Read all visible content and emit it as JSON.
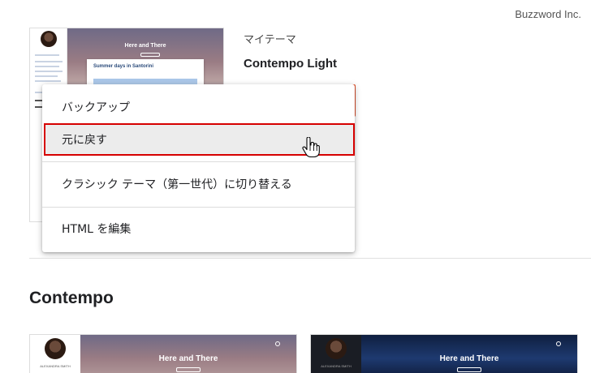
{
  "watermark": "Buzzword Inc.",
  "my_theme": {
    "label": "マイテーマ",
    "name": "Contempo Light",
    "preview": {
      "hero_title": "Here and There",
      "post_title": "Summer days in Santorini"
    }
  },
  "menu": {
    "items": [
      {
        "label": "バックアップ"
      },
      {
        "label": "元に戻す"
      },
      {
        "label": "クラシック テーマ（第一世代）に切り替える"
      },
      {
        "label": "HTML を編集"
      }
    ]
  },
  "section": {
    "title": "Contempo"
  },
  "thumbnails": [
    {
      "hero_title": "Here and There",
      "name": "ALEXANDRA SMITH"
    },
    {
      "hero_title": "Here and There",
      "name": "ALEXANDRA SMITH"
    }
  ],
  "colors": {
    "highlight_outline": "#d60000",
    "apply_button": "#e4512b"
  }
}
